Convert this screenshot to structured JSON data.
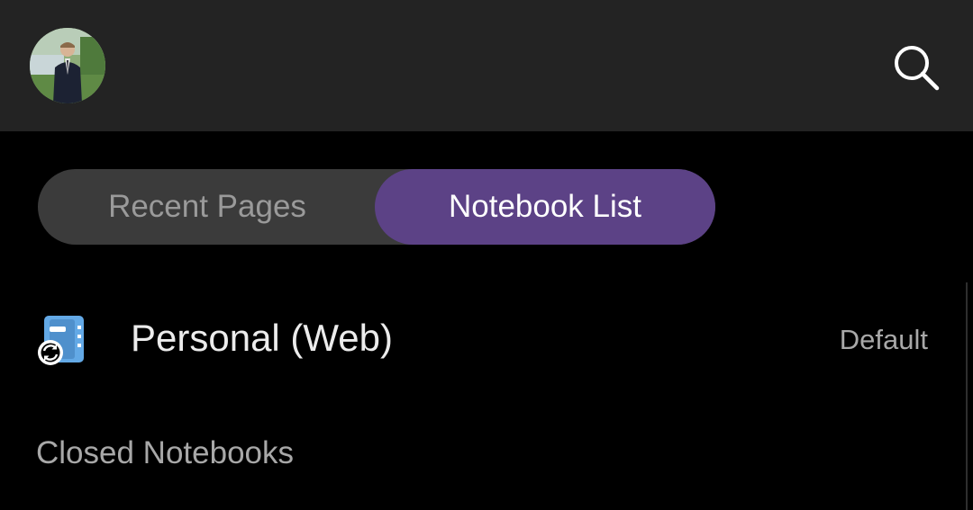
{
  "header": {
    "avatar_icon": "profile-photo",
    "search_icon": "search-icon"
  },
  "tabs": [
    {
      "label": "Recent Pages",
      "selected": false
    },
    {
      "label": "Notebook List",
      "selected": true
    }
  ],
  "colors": {
    "app_bar": "#232323",
    "background": "#000000",
    "accent": "#5c4286",
    "notebook_icon": "#63a9e6"
  },
  "notebooks": [
    {
      "name": "Personal (Web)",
      "badge": "Default",
      "icon": "sync-notebook-icon"
    }
  ],
  "sections": {
    "closed_header": "Closed Notebooks"
  }
}
